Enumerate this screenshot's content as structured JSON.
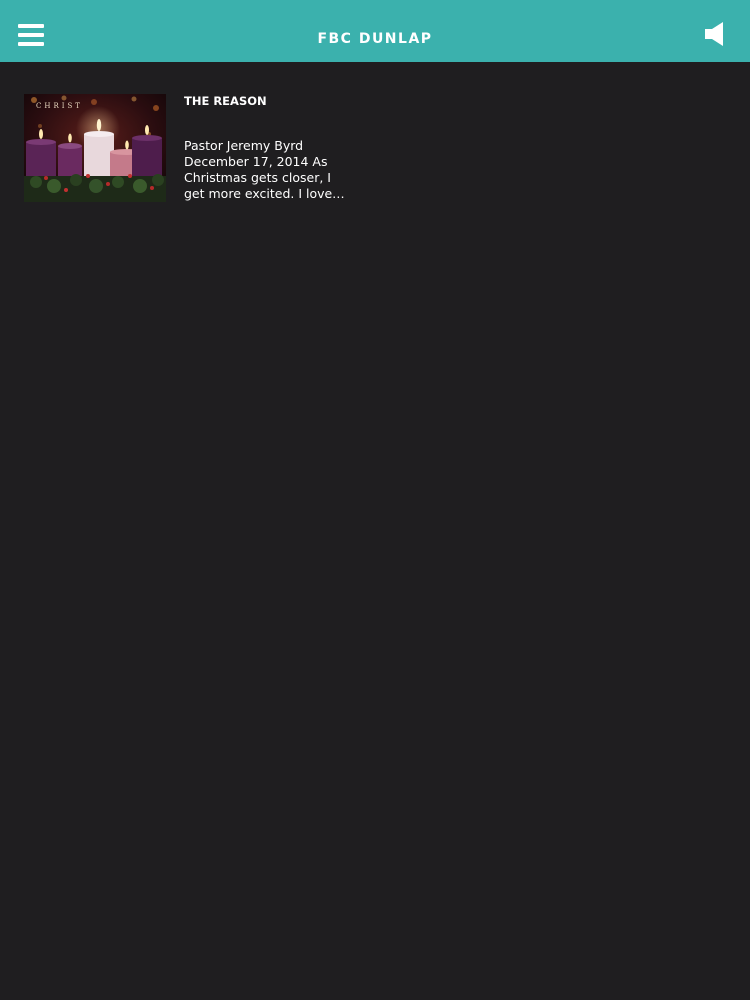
{
  "header": {
    "title": "FBC DUNLAP",
    "menu_icon": "hamburger-menu-icon",
    "speaker_icon": "speaker-icon",
    "background_color": "#3bb1ad"
  },
  "posts": [
    {
      "title": "THE REASON",
      "excerpt": "Pastor Jeremy Byrd December 17, 2014   As Christmas gets closer, I get more excited. I love…",
      "thumbnail": {
        "caption": "CHRIST",
        "description_icon": "advent-candles-image"
      }
    }
  ],
  "colors": {
    "background": "#1f1e20",
    "accent": "#3bb1ad",
    "text": "#ffffff"
  }
}
